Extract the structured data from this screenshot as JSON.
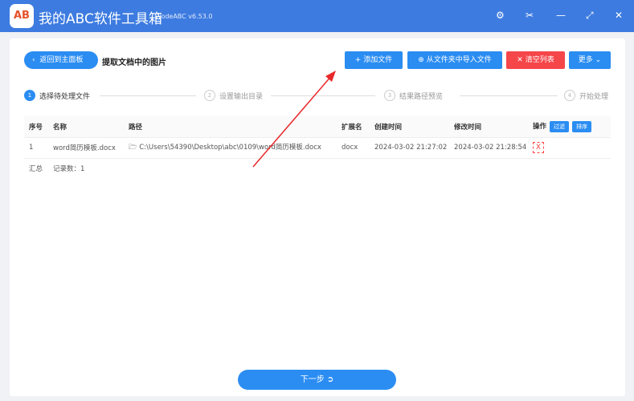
{
  "titlebar": {
    "logo": "AB",
    "title": "我的ABC软件工具箱",
    "version": "WodeABC v6.53.0"
  },
  "toolbar": {
    "back": "返回到主面板",
    "page_title": "提取文档中的图片",
    "add_file": "添加文件",
    "import_folder": "从文件夹中导入文件",
    "clear_list": "清空列表",
    "more": "更多"
  },
  "steps": [
    {
      "num": "1",
      "label": "选择待处理文件"
    },
    {
      "num": "2",
      "label": "设置输出目录"
    },
    {
      "num": "3",
      "label": "结果路径预览"
    },
    {
      "num": "4",
      "label": "开始处理"
    }
  ],
  "table": {
    "headers": {
      "index": "序号",
      "name": "名称",
      "path": "路径",
      "ext": "扩展名",
      "created": "创建时间",
      "modified": "修改时间",
      "actions": "操作",
      "filter": "过滤",
      "sort": "排序"
    },
    "rows": [
      {
        "index": "1",
        "name": "word简历模板.docx",
        "path": "C:\\Users\\54390\\Desktop\\abc\\0109\\word简历模板.docx",
        "ext": "docx",
        "created": "2024-03-02 21:27:02",
        "modified": "2024-03-02 21:28:54",
        "delete": "X"
      }
    ],
    "summary_label": "汇总",
    "summary_value": "记录数：1"
  },
  "footer": {
    "next": "下一步"
  },
  "colors": {
    "accent": "#2b8df2",
    "danger": "#f5464a",
    "titlebar": "#3d7be0"
  }
}
